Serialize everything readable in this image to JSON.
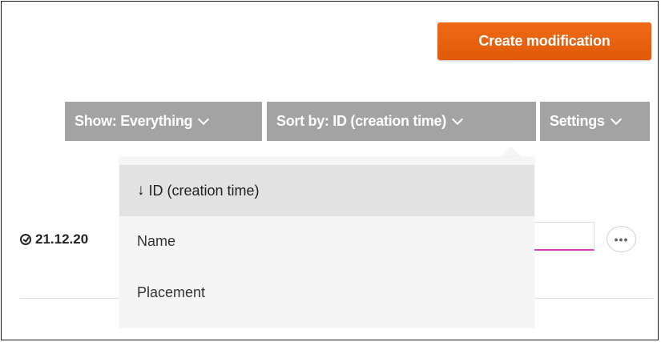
{
  "header": {
    "create_button_label": "Create modification"
  },
  "filters": {
    "show_label": "Show: Everything",
    "sort_label": "Sort by: ID (creation time)",
    "settings_label": "Settings"
  },
  "sort_menu": {
    "items": [
      {
        "label": "ID (creation time)",
        "icon": "arrow-down-icon",
        "selected": true
      },
      {
        "label": "Name",
        "selected": false
      },
      {
        "label": "Placement",
        "selected": false
      }
    ]
  },
  "row": {
    "date_text": "21.12.20",
    "more_label": "•••"
  },
  "colors": {
    "accent": "#e8620e",
    "filter_button": "#a3a3a3",
    "dropdown_bg": "#f5f5f5",
    "dropdown_selected_bg": "#e2e2e2",
    "input_underline": "#d63fc9"
  }
}
